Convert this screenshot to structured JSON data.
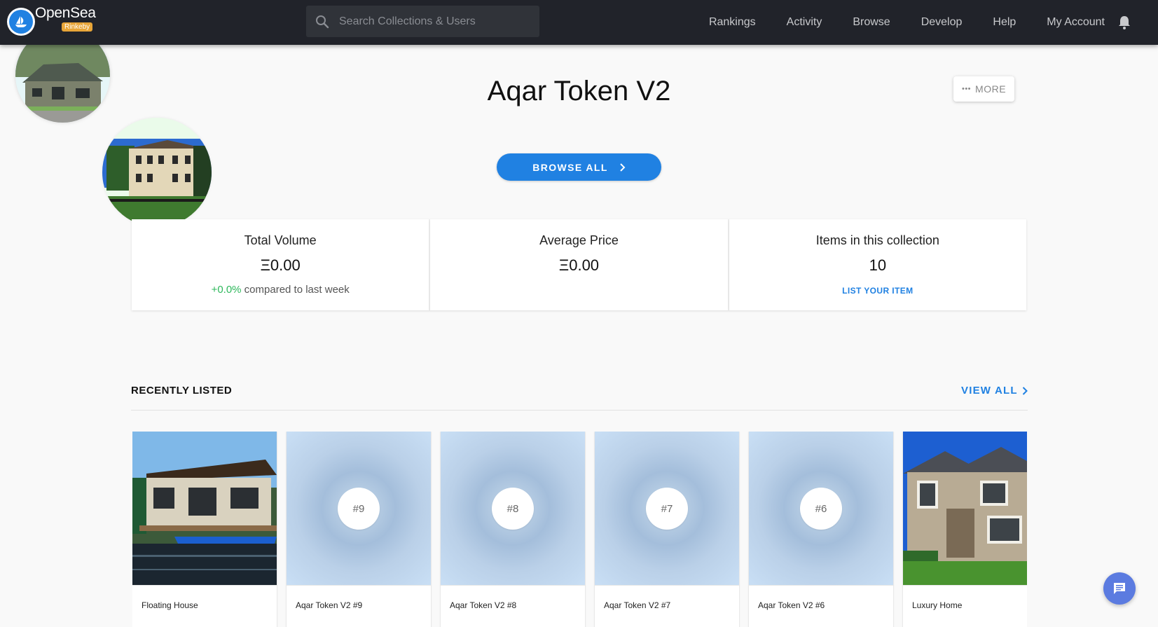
{
  "nav": {
    "brand": "OpenSea",
    "network_badge": "Rinkeby",
    "search_placeholder": "Search Collections & Users",
    "links": [
      "Rankings",
      "Activity",
      "Browse",
      "Develop",
      "Help",
      "My Account"
    ]
  },
  "collection": {
    "title": "Aqar Token V2",
    "more_label": "MORE",
    "browse_all_label": "BROWSE ALL"
  },
  "stats": [
    {
      "label": "Total Volume",
      "value": "Ξ0.00",
      "change": "+0.0%",
      "change_suffix": " compared to last week"
    },
    {
      "label": "Average Price",
      "value": "Ξ0.00"
    },
    {
      "label": "Items in this collection",
      "value": "10",
      "link": "LIST YOUR ITEM"
    }
  ],
  "recently_listed": {
    "heading": "RECENTLY LISTED",
    "view_all": "VIEW ALL",
    "items": [
      {
        "title": "Floating House",
        "image": "houseboat-photo"
      },
      {
        "title": "Aqar Token V2 #9",
        "badge": "#9"
      },
      {
        "title": "Aqar Token V2 #8",
        "badge": "#8"
      },
      {
        "title": "Aqar Token V2 #7",
        "badge": "#7"
      },
      {
        "title": "Aqar Token V2 #6",
        "badge": "#6"
      },
      {
        "title": "Luxury Home",
        "image": "luxury-house-photo"
      }
    ]
  },
  "colors": {
    "nav_bg": "#21232a",
    "accent": "#2081e2",
    "positive": "#2eb85c",
    "badge": "#e8a538"
  }
}
